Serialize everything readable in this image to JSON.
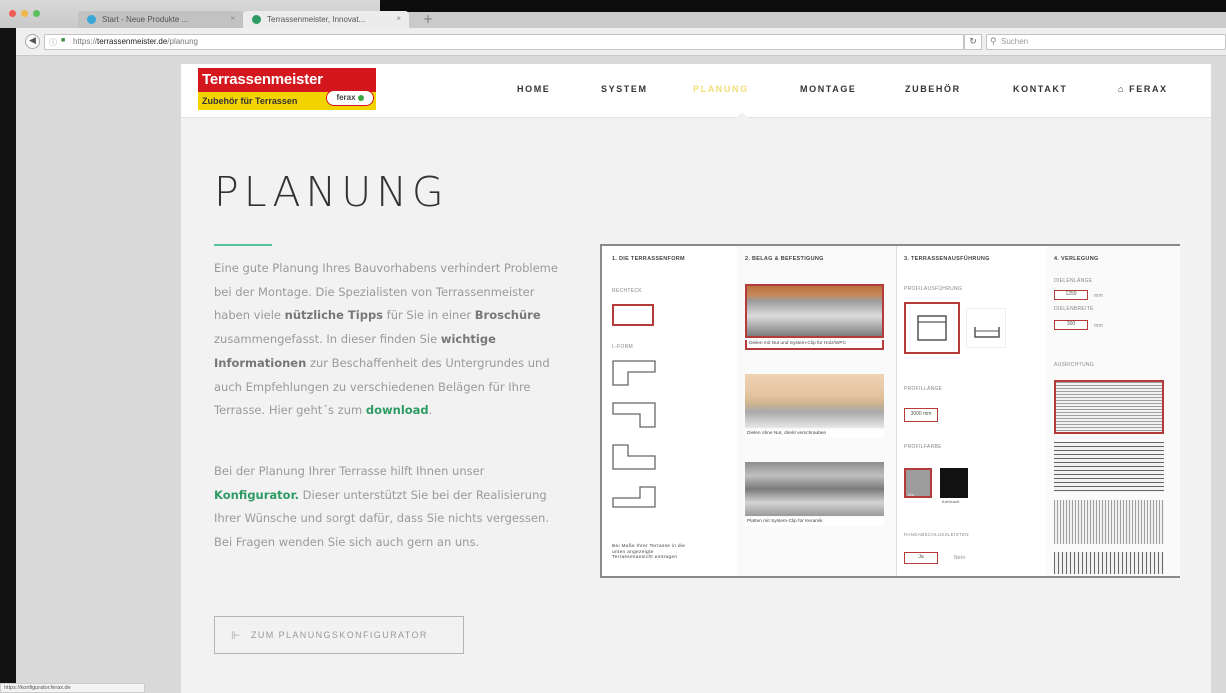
{
  "browser": {
    "tabs": [
      {
        "title": "Start - Neue Produkte ..."
      },
      {
        "title": "Terrassenmeister, Innovat..."
      }
    ],
    "url_prefix": "https://",
    "url_domain": "terrassenmeister.de",
    "url_path": "/planung",
    "search_placeholder": "Suchen",
    "status_url": "https://konfigurator.ferax.de"
  },
  "logo": {
    "top": "Terrassenmeister",
    "bottom": "Zubehör für Terrassen",
    "badge": "ferax"
  },
  "nav": [
    {
      "label": "HOME"
    },
    {
      "label": "SYSTEM"
    },
    {
      "label": "PLANUNG"
    },
    {
      "label": "MONTAGE"
    },
    {
      "label": "ZUBEHÖR"
    },
    {
      "label": "KONTAKT"
    },
    {
      "label": "FERAX"
    }
  ],
  "page": {
    "title": "PLANUNG",
    "p1_a": "Eine gute Planung Ihres Bauvorhabens verhindert Probleme bei der Montage. Die Spezialisten von Terrassenmeister haben viele ",
    "p1_b": "nützliche Tipps",
    "p1_c": " für Sie in einer ",
    "p1_d": "Broschüre",
    "p1_e": " zusammengefasst. In dieser finden Sie ",
    "p1_f": "wichtige Informationen",
    "p1_g": " zur Beschaffenheit des Untergrundes und auch Empfehlungen zu verschiedenen Belägen für Ihre Terrasse. Hier geht´s zum ",
    "p1_link": "download",
    "p1_end": ".",
    "p2_a": "Bei der Planung Ihrer Terrasse hilft Ihnen unser ",
    "p2_link": "Konfigurator.",
    "p2_b": " Dieser unterstützt Sie bei der Realisierung Ihrer Wünsche und sorgt dafür, dass Sie nichts vergessen. Bei Fragen wenden Sie sich auch gern an uns.",
    "cta": "ZUM PLANUNGSKONFIGURATOR"
  },
  "configurator": {
    "col1": {
      "title": "1. DIE TERRASSENFORM",
      "rechteck": "RECHTECK",
      "lform": "L-FORM",
      "note": "Bei Maße Ihrer Terrasse in die unten angezeigte Terrassenansicht eintragen"
    },
    "col2": {
      "title": "2. BELAG & BEFESTIGUNG",
      "cap1": "Dielen mit Nut und System-Clip für Holz/WPC",
      "cap2": "Dielen ohne Nut, direkt verschrauben",
      "cap3": "Platten mit System-Clip für Keramik"
    },
    "col3": {
      "title": "3. TERRASSENAUSFÜHRUNG",
      "profil": "PROFILAUSFÜHRUNG",
      "profillaenge": "PROFILLÄNGE",
      "laenge_val": "3000 mm",
      "profilfarbe": "PROFILFARBE",
      "farbe1": "Alu",
      "farbe2": "Anthrazit",
      "randab": "RANDABSCHLUSSLEISTEN",
      "ja": "Ja",
      "nein": "Nein"
    },
    "col4": {
      "title": "4. VERLEGUNG",
      "dielenlaenge": "DIELENLÄNGE",
      "laenge": "1250",
      "dielenbreite": "DIELENBREITE",
      "breite": "300",
      "unit": "mm",
      "ausrichtung": "AUSRICHTUNG"
    }
  },
  "colors": {
    "accent_green": "#59c39e",
    "link_green": "#2e9b63",
    "nav_active": "#f4dd77",
    "brand_red": "#d4161d",
    "brand_yellow": "#f4d400"
  }
}
